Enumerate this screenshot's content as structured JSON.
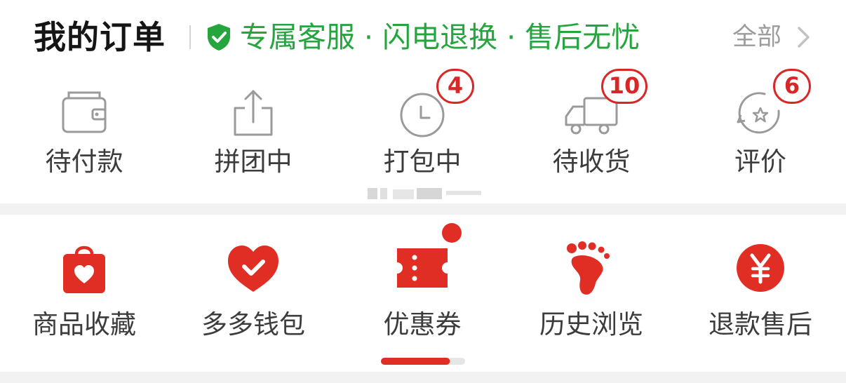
{
  "orders": {
    "title": "我的订单",
    "promise": "专属客服 · 闪电退换 · 售后无忧",
    "all_label": "全部",
    "items": [
      {
        "label": "待付款",
        "icon": "wallet-icon",
        "badge": ""
      },
      {
        "label": "拼团中",
        "icon": "share-icon",
        "badge": ""
      },
      {
        "label": "打包中",
        "icon": "clock-icon",
        "badge": "4"
      },
      {
        "label": "待收货",
        "icon": "truck-icon",
        "badge": "10"
      },
      {
        "label": "评价",
        "icon": "review-star-icon",
        "badge": "6"
      }
    ]
  },
  "services": {
    "items": [
      {
        "label": "商品收藏",
        "icon": "favorites-bag-icon"
      },
      {
        "label": "多多钱包",
        "icon": "wallet-heart-icon"
      },
      {
        "label": "优惠券",
        "icon": "coupon-icon",
        "has_dot": true
      },
      {
        "label": "历史浏览",
        "icon": "footprint-icon"
      },
      {
        "label": "退款售后",
        "icon": "refund-yuan-icon"
      }
    ],
    "page_indicator_progress": 0.82
  },
  "colors": {
    "accent_red": "#e02e24",
    "badge_red": "#d92626",
    "promise_green": "#24a53d",
    "icon_gray": "#9a9a9a"
  }
}
